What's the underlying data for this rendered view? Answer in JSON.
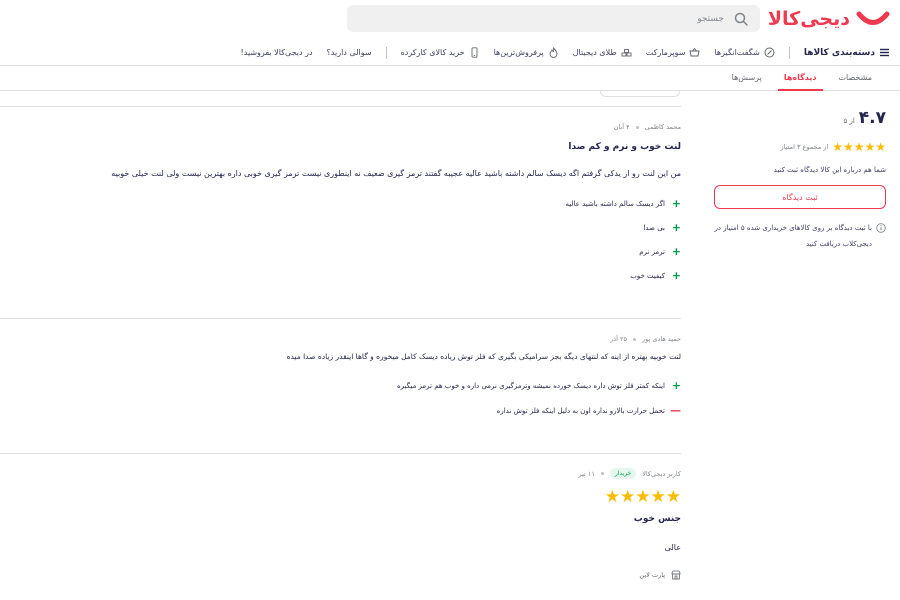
{
  "header": {
    "logo": "دیجی‌کالا",
    "search_placeholder": "جستجو"
  },
  "nav": {
    "items": [
      {
        "label": "دسته‌بندی کالاها",
        "icon": "menu-icon"
      },
      {
        "label": "شگفت‌انگیزها",
        "icon": "percent-icon"
      },
      {
        "label": "سوپرمارکت",
        "icon": "basket-icon"
      },
      {
        "label": "طلای دیجیتال",
        "icon": "gold-icon"
      },
      {
        "label": "پرفروش‌ترین‌ها",
        "icon": "fire-icon"
      },
      {
        "label": "خرید کالای کارکرده",
        "icon": "phone-icon"
      },
      {
        "label": "سوالی دارید؟",
        "icon": ""
      },
      {
        "label": "در دیجی‌کالا بفروشید!",
        "icon": ""
      }
    ]
  },
  "tabs": [
    {
      "label": "مشخصات",
      "active": false
    },
    {
      "label": "دیدگاه‌ها",
      "active": true
    },
    {
      "label": "پرسش‌ها",
      "active": false
    }
  ],
  "sidebar": {
    "rating": "۴.۷",
    "rating_of": "از ۵",
    "stars": "★★★★★",
    "rating_count": "از مجموع ۳ امتیاز",
    "note": "شما هم درباره این کالا دیدگاه ثبت کنید",
    "button": "ثبت دیدگاه",
    "info": "با ثبت دیدگاه بر روی کالاهای خریداری شده ۵ امتیاز در دیجی‌کلاب دریافت کنید"
  },
  "reviews": [
    {
      "author": "محمد کاظمی",
      "date": "۴ آبان",
      "title": "لنت خوب و نرم و کم صدا",
      "body": "من این لنت رو از یدکی گرفتم اگه دیسک سالم داشته باشید عالیه عجیبه گفتند ترمز گیری ضعیف نه اینطوری نیست ترمز گیری خوبی داره بهترین نیست ولی لنت خیلی خوبیه",
      "points": [
        {
          "type": "plus",
          "text": "اگر دیسک سالم داشته باشید عالیه"
        },
        {
          "type": "plus",
          "text": "بی صدا"
        },
        {
          "type": "plus",
          "text": "ترمز نرم"
        },
        {
          "type": "plus",
          "text": "کیفیت خوب"
        }
      ]
    },
    {
      "author": "حمید هادی پور",
      "date": "۲۵ آذر",
      "body": "لنت خوبیه بهتره از اینه که لنتهای دیگه بجز سرامیکی بگیری که فلز توش زیاده دیسک کامل میخوره و گاها اینقدر زیاده صدا میده",
      "points": [
        {
          "type": "plus",
          "text": "اینکه کمتر فلز توش داره دیسک خورده نمیشه وترمزگیری نرمی داره و خوب هم ترمز میگیره"
        },
        {
          "type": "minus",
          "text": "تحمل حرارت بالارو نداره اون به دلیل اینکه فلز توش نداره"
        }
      ]
    },
    {
      "author": "کاربر دیجی‌کالا",
      "badge": "خریدار",
      "date": "۱۱ تیر",
      "stars": "★★★★★",
      "title": "جنس خوب",
      "body": "عالی",
      "seller": "پارت لاین"
    }
  ],
  "colors": {
    "brand": "#ef394e",
    "star": "#f9bc00",
    "positive": "#00a049"
  }
}
